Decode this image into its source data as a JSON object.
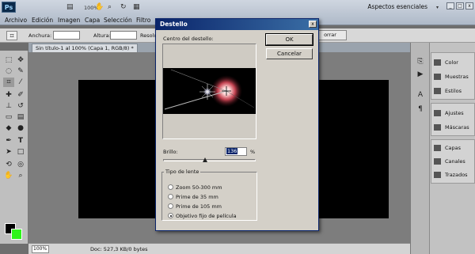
{
  "app": {
    "logo": "Ps",
    "zoom": "100%",
    "workspace": "Aspectos esenciales"
  },
  "menu": [
    "Archivo",
    "Edición",
    "Imagen",
    "Capa",
    "Selección",
    "Filtro"
  ],
  "options_bar": {
    "width_label": "Anchura:",
    "height_label": "Altura:",
    "resolution_label": "Resolu",
    "clear_button": "orrar"
  },
  "document": {
    "tab_title": "Sin título-1 al 100% (Capa 1, RGB/8) *",
    "status_zoom": "100%",
    "status_info": "Doc: 527,3 KB/0 bytes"
  },
  "dialog": {
    "title": "Destello",
    "close": "x",
    "center_label": "Centro del destello:",
    "ok": "OK",
    "cancel": "Cancelar",
    "brightness_label": "Brillo:",
    "brightness_value": "136",
    "brightness_unit": "%",
    "brightness_slider_fraction": 0.45,
    "lens_group_label": "Tipo de lente",
    "lens_options": [
      {
        "label": "Zoom 50-300 mm",
        "selected": false
      },
      {
        "label": "Prime de 35 mm",
        "selected": false
      },
      {
        "label": "Prime de 105 mm",
        "selected": false
      },
      {
        "label": "Objetivo fijo de película",
        "selected": true
      }
    ]
  },
  "panels": [
    {
      "group": 1,
      "items": [
        {
          "label": "Color",
          "icon": "color-icon"
        },
        {
          "label": "Muestras",
          "icon": "swatches-icon"
        },
        {
          "label": "Estilos",
          "icon": "styles-icon"
        }
      ]
    },
    {
      "group": 2,
      "items": [
        {
          "label": "Ajustes",
          "icon": "adjustments-icon"
        },
        {
          "label": "Máscaras",
          "icon": "masks-icon"
        }
      ]
    },
    {
      "group": 3,
      "items": [
        {
          "label": "Capas",
          "icon": "layers-icon"
        },
        {
          "label": "Canales",
          "icon": "channels-icon"
        },
        {
          "label": "Trazados",
          "icon": "paths-icon"
        }
      ]
    }
  ],
  "colors": {
    "foreground": "#000000",
    "background": "#2ef51a",
    "dialog_title": "#0a246a"
  }
}
